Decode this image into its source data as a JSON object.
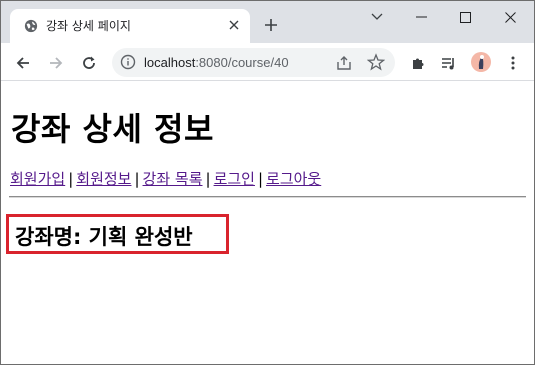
{
  "browser": {
    "tab_title": "강좌 상세 페이지",
    "url_host": "localhost",
    "url_path": ":8080/course/40"
  },
  "icons": {
    "favicon": "globe-icon",
    "tab_close": "close-icon",
    "new_tab": "plus-icon",
    "back": "arrow-left-icon",
    "forward": "arrow-right-icon",
    "reload": "reload-icon",
    "site_info": "info-icon",
    "share": "share-icon",
    "bookmark": "star-icon",
    "extensions": "puzzle-icon",
    "media": "media-playlist-icon",
    "menu": "kebab-menu-icon"
  },
  "page": {
    "title": "강좌 상세 정보",
    "nav": [
      {
        "label": "회원가입"
      },
      {
        "label": "회원정보"
      },
      {
        "label": "강좌 목록"
      },
      {
        "label": "로그인"
      },
      {
        "label": "로그아웃"
      }
    ],
    "nav_separator": "|",
    "course_name": "강좌명: 기획 완성반"
  },
  "colors": {
    "link_visited": "#551a8b",
    "highlight_border": "#d9232d",
    "tabstrip_bg": "#dee1e6"
  }
}
